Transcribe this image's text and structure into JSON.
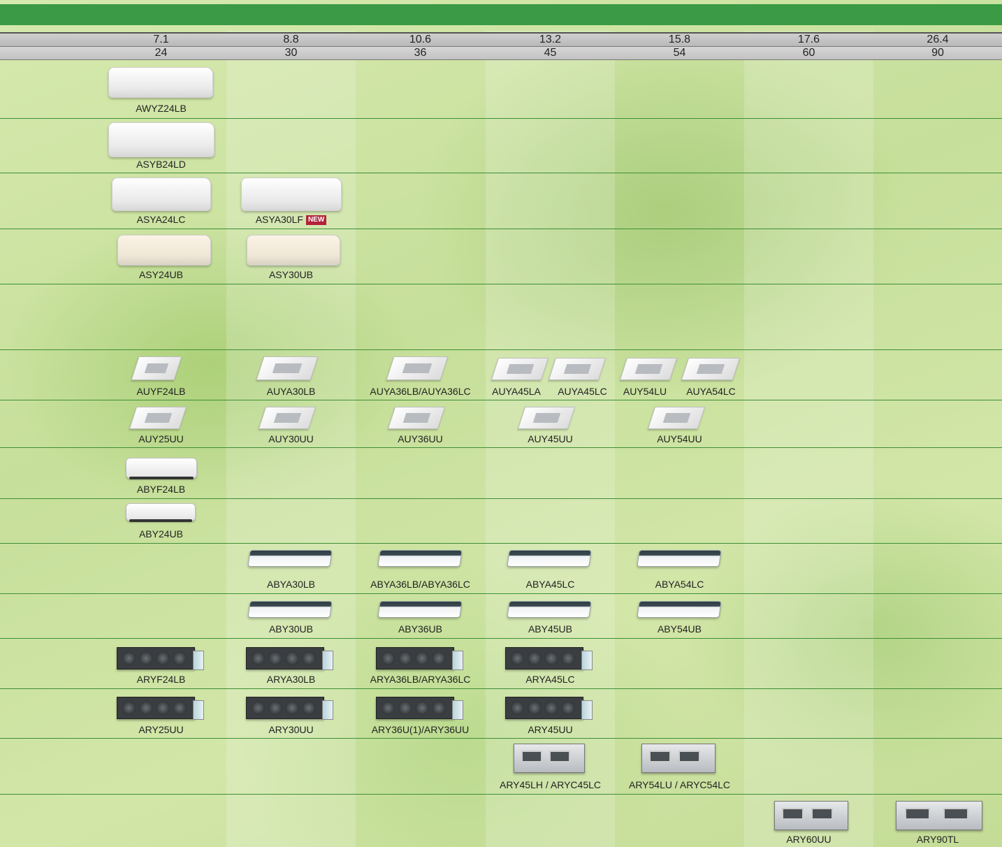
{
  "header": {
    "row1": [
      "7.1",
      "8.8",
      "10.6",
      "13.2",
      "15.8",
      "17.6",
      "26.4"
    ],
    "row2": [
      "24",
      "30",
      "36",
      "45",
      "54",
      "60",
      "90"
    ]
  },
  "labels": {
    "awyz24lb": "AWYZ24LB",
    "asyb24ld": "ASYB24LD",
    "asya24lc": "ASYA24LC",
    "asya30lf": "ASYA30LF",
    "new_badge": "NEW",
    "asy24ub": "ASY24UB",
    "asy30ub": "ASY30UB",
    "auyf24lb": "AUYF24LB",
    "auya30lb": "AUYA30LB",
    "auya36": "AUYA36LB/AUYA36LC",
    "auya45la": "AUYA45LA",
    "auya45lc": "AUYA45LC",
    "auy54lu": "AUY54LU",
    "auya54lc": "AUYA54LC",
    "auy25uu": "AUY25UU",
    "auy30uu": "AUY30UU",
    "auy36uu": "AUY36UU",
    "auy45uu": "AUY45UU",
    "auy54uu": "AUY54UU",
    "abyf24lb": "ABYF24LB",
    "aby24ub": "ABY24UB",
    "abya30lb": "ABYA30LB",
    "abya36": "ABYA36LB/ABYA36LC",
    "abya45lc": "ABYA45LC",
    "abya54lc": "ABYA54LC",
    "aby30ub": "ABY30UB",
    "aby36ub": "ABY36UB",
    "aby45ub": "ABY45UB",
    "aby54ub": "ABY54UB",
    "aryf24lb": "ARYF24LB",
    "arya30lb": "ARYA30LB",
    "arya36": "ARYA36LB/ARYA36LC",
    "arya45lc": "ARYA45LC",
    "ary25uu": "ARY25UU",
    "ary30uu": "ARY30UU",
    "ary36": "ARY36U(1)/ARY36UU",
    "ary45uu": "ARY45UU",
    "ary45lh": "ARY45LH / ARYC45LC",
    "ary54lu": "ARY54LU / ARYC54LC",
    "ary60uu": "ARY60UU",
    "ary90tl": "ARY90TL"
  },
  "colors": {
    "top_band": "#3a9a45",
    "row_divider": "#3d8f36",
    "new_badge": "#b3223a"
  }
}
